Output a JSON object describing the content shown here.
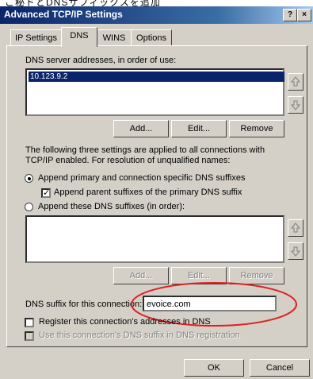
{
  "top_strip_text": "こ秘ドとDNSサフィックスを追加",
  "window": {
    "title": "Advanced TCP/IP Settings",
    "help_button": "?",
    "close_button": "×"
  },
  "tabs": [
    {
      "label": "IP Settings",
      "active": false
    },
    {
      "label": "DNS",
      "active": true
    },
    {
      "label": "WINS",
      "active": false
    },
    {
      "label": "Options",
      "active": false
    }
  ],
  "dns_servers": {
    "label": "DNS server addresses, in order of use:",
    "items": [
      "10.123.9.2"
    ],
    "add": "Add...",
    "edit": "Edit...",
    "remove": "Remove"
  },
  "resolution_text": "The following three settings are applied to all connections with TCP/IP enabled. For resolution of unqualified names:",
  "options": {
    "append_primary": "Append primary and connection specific DNS suffixes",
    "append_parent": "Append parent suffixes of the primary DNS suffix",
    "append_these": "Append these DNS suffixes (in order):"
  },
  "suffix_list": {
    "add": "Add...",
    "edit": "Edit...",
    "remove": "Remove"
  },
  "dns_suffix": {
    "label": "DNS suffix for this connection:",
    "value": "evoice.com"
  },
  "register_label": "Register this connection's addresses in DNS",
  "use_suffix_label": "Use this connection's DNS suffix in DNS registration",
  "footer": {
    "ok": "OK",
    "cancel": "Cancel"
  },
  "colors": {
    "annotation_ellipse": "#e02020",
    "title_bar": "#0a246a"
  }
}
